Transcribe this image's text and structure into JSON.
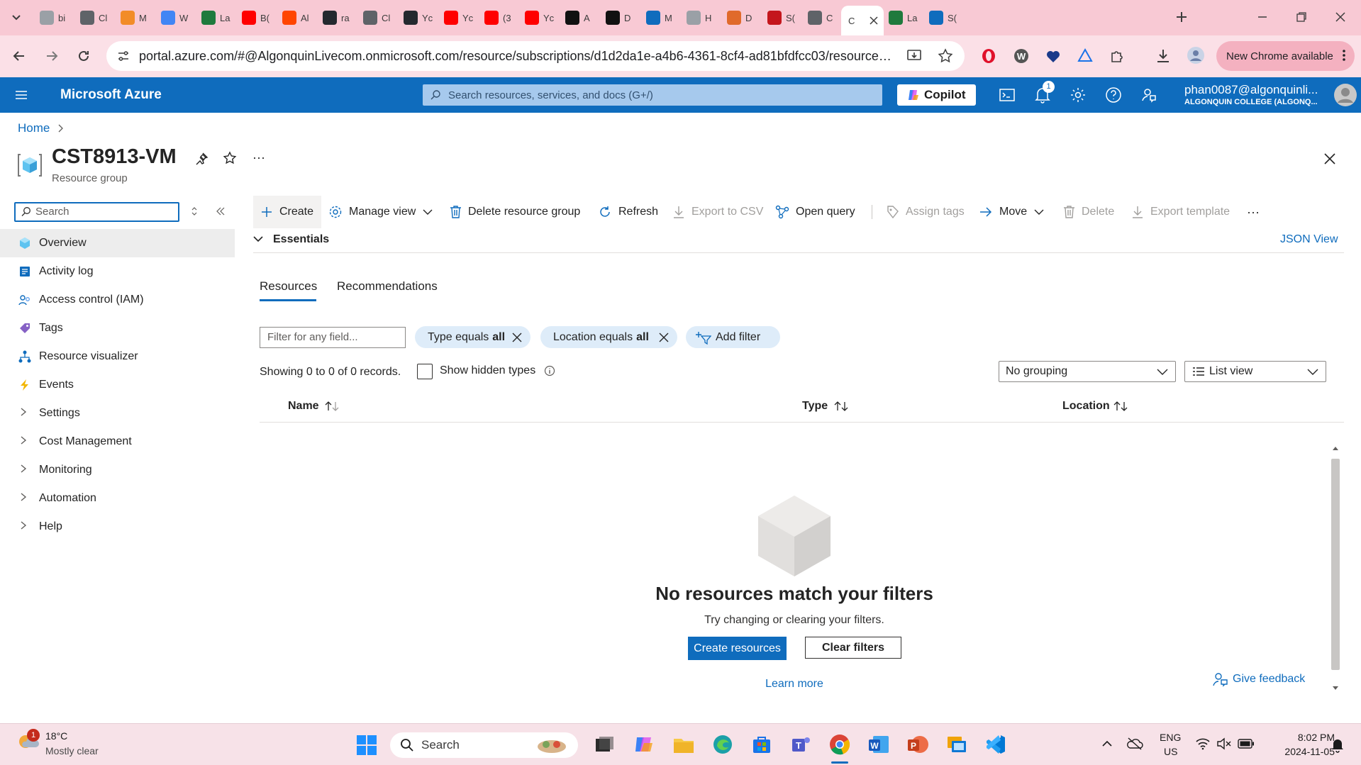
{
  "browser": {
    "tabs": [
      {
        "label": "bi",
        "color": "#9aa0a6"
      },
      {
        "label": "Cl",
        "color": "#5f6368"
      },
      {
        "label": "M",
        "color": "#f28c28"
      },
      {
        "label": "W",
        "color": "#4285f4"
      },
      {
        "label": "La",
        "color": "#1f7a3d"
      },
      {
        "label": "B(",
        "color": "#ff0000"
      },
      {
        "label": "Al",
        "color": "#ff4500"
      },
      {
        "label": "ra",
        "color": "#24292f"
      },
      {
        "label": "Cl",
        "color": "#5f6368"
      },
      {
        "label": "Yc",
        "color": "#24292f"
      },
      {
        "label": "Yc",
        "color": "#ff0000"
      },
      {
        "label": "(3",
        "color": "#ff0000"
      },
      {
        "label": "Yc",
        "color": "#ff0000"
      },
      {
        "label": "A",
        "color": "#111111"
      },
      {
        "label": "D",
        "color": "#111111"
      },
      {
        "label": "M",
        "color": "#0f6cbd"
      },
      {
        "label": "H",
        "color": "#9aa0a6"
      },
      {
        "label": "D",
        "color": "#e06a2b"
      },
      {
        "label": "S(",
        "color": "#c4161c"
      },
      {
        "label": "C",
        "color": "#5f6368"
      },
      {
        "label": "C",
        "color": "#5f6368",
        "active": true
      },
      {
        "label": "La",
        "color": "#1f7a3d"
      },
      {
        "label": "S(",
        "color": "#0f6cbd"
      }
    ],
    "url": "portal.azure.com/#@AlgonquinLivecom.onmicrosoft.com/resource/subscriptions/d1d2da1e-a4b6-4361-8cf4-ad81bfdfcc03/resourcegro...",
    "new_chrome_label": "New Chrome available"
  },
  "azure": {
    "brand": "Microsoft Azure",
    "search_placeholder": "Search resources, services, and docs (G+/)",
    "copilot_label": "Copilot",
    "notification_count": "1",
    "account_name": "phan0087@algonquinli...",
    "account_org": "ALGONQUIN COLLEGE (ALGONQ..."
  },
  "breadcrumb": {
    "home": "Home"
  },
  "page": {
    "title": "CST8913-VM",
    "subtitle": "Resource group",
    "more": "···"
  },
  "sidebar": {
    "search_placeholder": "Search",
    "items": [
      {
        "label": "Overview",
        "icon": "cube-icon",
        "selected": true
      },
      {
        "label": "Activity log",
        "icon": "activity-log-icon"
      },
      {
        "label": "Access control (IAM)",
        "icon": "people-icon"
      },
      {
        "label": "Tags",
        "icon": "tag-icon"
      },
      {
        "label": "Resource visualizer",
        "icon": "hierarchy-icon"
      },
      {
        "label": "Events",
        "icon": "lightning-icon"
      },
      {
        "label": "Settings",
        "icon": "chevron-right-icon"
      },
      {
        "label": "Cost Management",
        "icon": "chevron-right-icon"
      },
      {
        "label": "Monitoring",
        "icon": "chevron-right-icon"
      },
      {
        "label": "Automation",
        "icon": "chevron-right-icon"
      },
      {
        "label": "Help",
        "icon": "chevron-right-icon"
      }
    ]
  },
  "toolbar": {
    "create": "Create",
    "manage_view": "Manage view",
    "delete_rg": "Delete resource group",
    "refresh": "Refresh",
    "export_csv": "Export to CSV",
    "open_query": "Open query",
    "assign_tags": "Assign tags",
    "move": "Move",
    "delete": "Delete",
    "export_template": "Export template",
    "more": "···"
  },
  "essentials": {
    "label": "Essentials",
    "json_view": "JSON View"
  },
  "tabs": {
    "resources": "Resources",
    "recommendations": "Recommendations"
  },
  "filters": {
    "placeholder": "Filter for any field...",
    "type_prefix": "Type equals",
    "type_value": "all",
    "location_prefix": "Location equals",
    "location_value": "all",
    "add_filter": "Add filter"
  },
  "records": {
    "showing": "Showing 0 to 0 of 0 records.",
    "show_hidden": "Show hidden types",
    "grouping": "No grouping",
    "view": "List view"
  },
  "columns": {
    "name": "Name",
    "type": "Type",
    "location": "Location"
  },
  "empty": {
    "title": "No resources match your filters",
    "subtitle": "Try changing or clearing your filters.",
    "create_button": "Create resources",
    "clear_button": "Clear filters",
    "learn_more": "Learn more",
    "feedback": "Give feedback"
  },
  "taskbar": {
    "weather_badge": "1",
    "temperature": "18°C",
    "weather": "Mostly clear",
    "search": "Search",
    "lang": "ENG",
    "region": "US",
    "time": "8:02 PM",
    "date": "2024-11-05"
  }
}
